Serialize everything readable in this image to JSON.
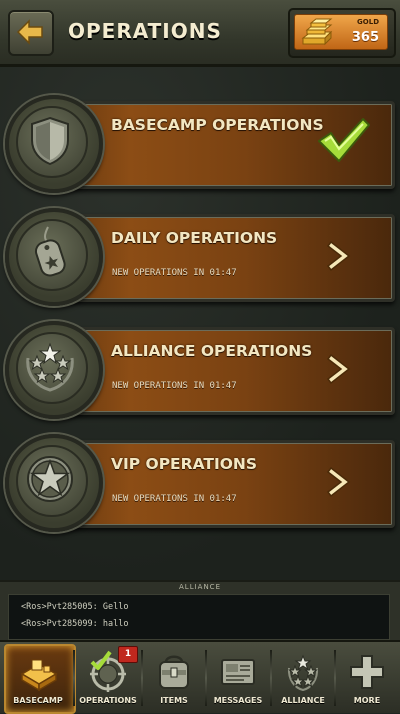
{
  "header": {
    "title": "OPERATIONS",
    "back_icon": "back-arrow-icon",
    "gold": {
      "label": "GOLD",
      "value": "365",
      "icon": "gold-bars-icon"
    }
  },
  "operations": [
    {
      "title": "BASECAMP OPERATIONS",
      "subtitle": "",
      "icon": "shield-icon",
      "status": "completed"
    },
    {
      "title": "DAILY OPERATIONS",
      "subtitle": "NEW OPERATIONS IN 01:47",
      "icon": "dog-tag-icon",
      "status": "available"
    },
    {
      "title": "ALLIANCE OPERATIONS",
      "subtitle": "NEW OPERATIONS IN 01:47",
      "icon": "stars-icon",
      "status": "available"
    },
    {
      "title": "VIP OPERATIONS",
      "subtitle": "NEW OPERATIONS IN 01:47",
      "icon": "star-emblem-icon",
      "status": "available"
    }
  ],
  "chat": {
    "label": "ALLIANCE",
    "messages": [
      "<Ros>Pvt285005: Gello",
      "<Ros>Pvt285099: hallo"
    ]
  },
  "nav": {
    "items": [
      {
        "label": "BASECAMP",
        "icon": "basecamp-icon",
        "active": true
      },
      {
        "label": "OPERATIONS",
        "icon": "operations-icon",
        "badge": "1"
      },
      {
        "label": "ITEMS",
        "icon": "items-icon"
      },
      {
        "label": "MESSAGES",
        "icon": "messages-icon"
      },
      {
        "label": "ALLIANCE",
        "icon": "alliance-icon"
      },
      {
        "label": "MORE",
        "icon": "plus-icon"
      }
    ]
  },
  "colors": {
    "accent": "#f0a64a",
    "bar": "#7a4212",
    "check": "#9bd23a",
    "badge": "#c0281e"
  }
}
